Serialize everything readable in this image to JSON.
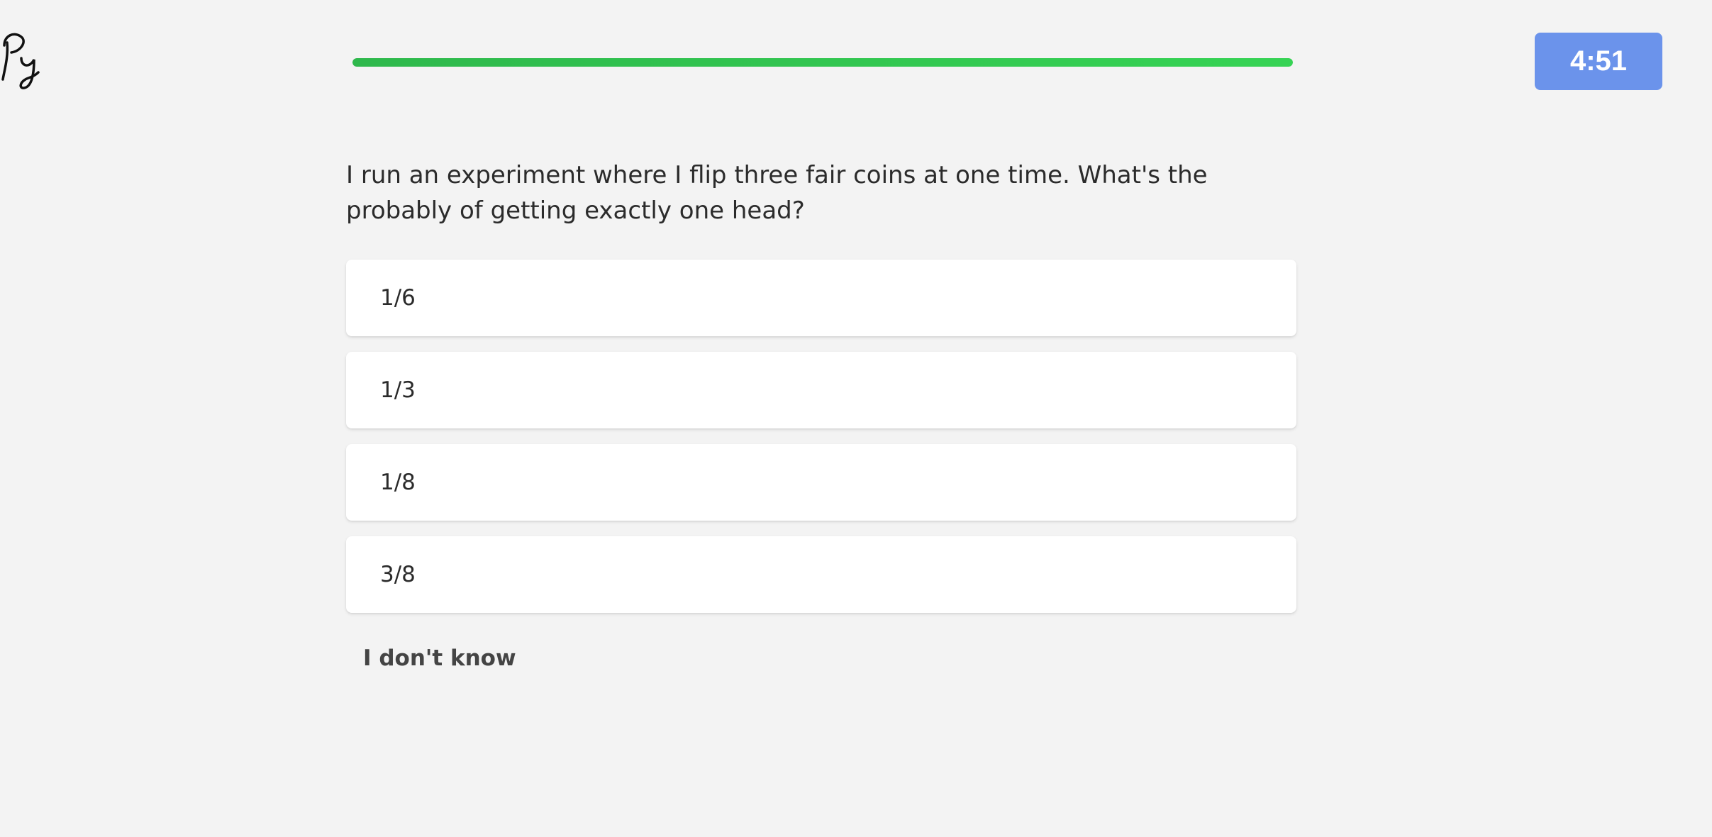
{
  "logo": {
    "icon": "py-script-logo-icon"
  },
  "progress": {
    "fraction": 1.0,
    "color": "#34c94f"
  },
  "timer": {
    "label": "4:51",
    "color": "#6b93eb"
  },
  "question": {
    "text": "I run an experiment where I flip three fair coins at one time. What's the probably of getting exactly one head?"
  },
  "options": [
    {
      "label": "1/6"
    },
    {
      "label": "1/3"
    },
    {
      "label": "1/8"
    },
    {
      "label": "3/8"
    }
  ],
  "dont_know": {
    "label": "I don't know"
  }
}
